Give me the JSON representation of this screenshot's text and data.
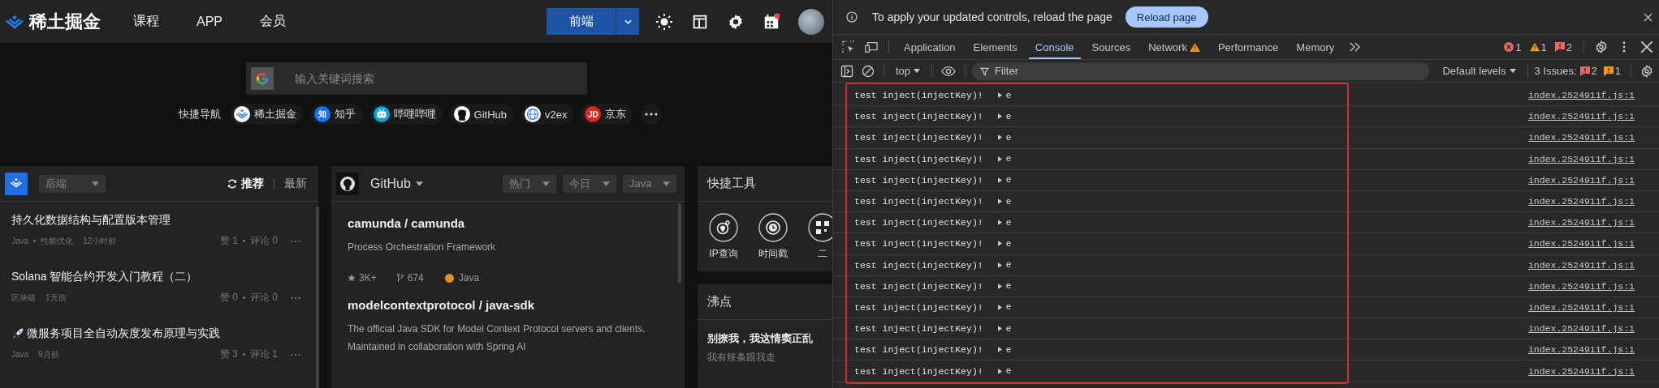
{
  "header": {
    "logo": "稀土掘金",
    "nav": [
      "课程",
      "APP",
      "会员"
    ],
    "category_button": "前端"
  },
  "search": {
    "placeholder": "输入关键词搜索"
  },
  "quick_nav": {
    "label": "快捷导航",
    "links": [
      {
        "label": "稀土掘金",
        "kind": "juejin"
      },
      {
        "label": "知乎",
        "kind": "badge",
        "icon_text": "知",
        "color": "#1772f6"
      },
      {
        "label": "哔哩哔哩",
        "kind": "tv"
      },
      {
        "label": "GitHub",
        "kind": "github"
      },
      {
        "label": "v2ex",
        "kind": "globe"
      },
      {
        "label": "京东",
        "kind": "badge",
        "icon_text": "JD",
        "color": "#e1251b"
      }
    ]
  },
  "articles": {
    "category": "后端",
    "tabs": [
      {
        "label": "推荐",
        "selected": true
      },
      {
        "label": "最新",
        "selected": false
      }
    ],
    "items": [
      {
        "title": "持久化数据结构与配置版本管理",
        "kind": "plain",
        "tags": [
          "Java",
          "性能优化"
        ],
        "time": "12小时前",
        "likes": "赞 1",
        "comments": "评论 0"
      },
      {
        "title": "Solana 智能合约开发入门教程（二）",
        "kind": "plain",
        "tags": [
          "区块链"
        ],
        "time": "1天前",
        "likes": "赞 0",
        "comments": "评论 0"
      },
      {
        "title": "微服务项目全自动灰度发布原理与实践",
        "kind": "rocket",
        "tags": [
          "Java"
        ],
        "time": "9月前",
        "likes": "赞 3",
        "comments": "评论 1"
      }
    ]
  },
  "github": {
    "title": "GitHub",
    "filters": [
      "热门",
      "今日",
      "Java"
    ],
    "repos": [
      {
        "name": "camunda / camunda",
        "description": "Process Orchestration Framework",
        "stars": "3K+",
        "forks": "674",
        "language": "Java",
        "color": "#d9912b"
      },
      {
        "name": "modelcontextprotocol / java-sdk",
        "description": "The official Java SDK for Model Context Protocol servers and clients. Maintained in collaboration with Spring AI"
      }
    ]
  },
  "tools": {
    "title": "快捷工具",
    "items": [
      {
        "label": "IP查询",
        "kind": "ip"
      },
      {
        "label": "时间戳",
        "kind": "clock"
      },
      {
        "label": "二",
        "kind": "qr"
      }
    ]
  },
  "hot": {
    "title": "沸点",
    "post": "别撩我，我这情窦正乱",
    "sub": "我有辣条跟我走"
  },
  "devtools": {
    "banner": {
      "message": "To apply your updated controls, reload the page",
      "button": "Reload page"
    },
    "tabs": [
      {
        "label": "Application",
        "selected": false,
        "warning": false
      },
      {
        "label": "Elements",
        "selected": false,
        "warning": false
      },
      {
        "label": "Console",
        "selected": true,
        "warning": false
      },
      {
        "label": "Sources",
        "selected": false,
        "warning": false
      },
      {
        "label": "Network",
        "selected": false,
        "warning": true
      },
      {
        "label": "Performance",
        "selected": false,
        "warning": false
      },
      {
        "label": "Memory",
        "selected": false,
        "warning": false
      }
    ],
    "errors": "1",
    "warnings": "1",
    "messages": "2",
    "context": "top",
    "filter_placeholder": "Filter",
    "levels": "Default levels",
    "issues_label": "3 Issues:",
    "issue_errors": "2",
    "issue_warnings": "1",
    "highlight_box": true,
    "rows": [
      {
        "message": "test inject(injectKey)!",
        "value": "e",
        "source": "index.2524911f.js:1"
      },
      {
        "message": "test inject(injectKey)!",
        "value": "e",
        "source": "index.2524911f.js:1"
      },
      {
        "message": "test inject(injectKey)!",
        "value": "e",
        "source": "index.2524911f.js:1"
      },
      {
        "message": "test inject(injectKey)!",
        "value": "e",
        "source": "index.2524911f.js:1"
      },
      {
        "message": "test inject(injectKey)!",
        "value": "e",
        "source": "index.2524911f.js:1"
      },
      {
        "message": "test inject(injectKey)!",
        "value": "e",
        "source": "index.2524911f.js:1"
      },
      {
        "message": "test inject(injectKey)!",
        "value": "e",
        "source": "index.2524911f.js:1"
      },
      {
        "message": "test inject(injectKey)!",
        "value": "e",
        "source": "index.2524911f.js:1"
      },
      {
        "message": "test inject(injectKey)!",
        "value": "e",
        "source": "index.2524911f.js:1"
      },
      {
        "message": "test inject(injectKey)!",
        "value": "e",
        "source": "index.2524911f.js:1"
      },
      {
        "message": "test inject(injectKey)!",
        "value": "e",
        "source": "index.2524911f.js:1"
      },
      {
        "message": "test inject(injectKey)!",
        "value": "e",
        "source": "index.2524911f.js:1"
      },
      {
        "message": "test inject(injectKey)!",
        "value": "e",
        "source": "index.2524911f.js:1"
      },
      {
        "message": "test inject(injectKey)!",
        "value": "e",
        "source": "index.2524911f.js:1"
      }
    ]
  }
}
